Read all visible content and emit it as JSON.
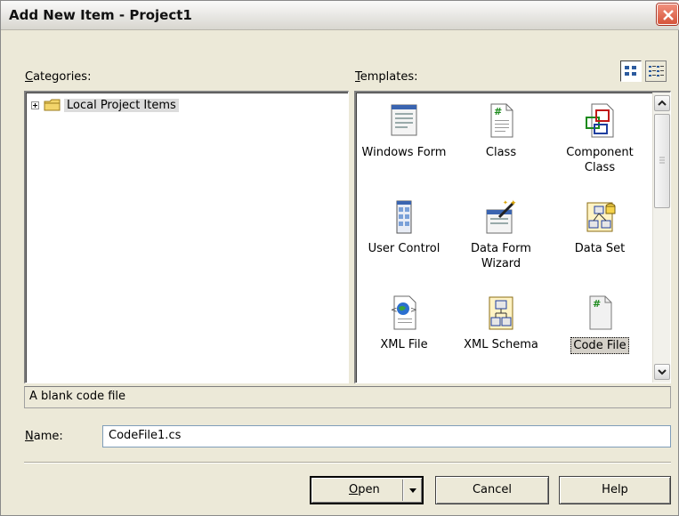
{
  "window": {
    "title": "Add New Item - Project1"
  },
  "categories": {
    "label_accel": "C",
    "label_rest": "ategories:",
    "tree": [
      {
        "label": "Local Project Items",
        "icon": "folder-icon",
        "expanded": false,
        "selected": true
      }
    ]
  },
  "templates": {
    "label_accel": "T",
    "label_rest": "emplates:",
    "view_large_icons": "large-icons-view-icon",
    "view_list": "list-view-icon",
    "items": [
      {
        "label": "Windows Form",
        "icon": "windows-form-icon"
      },
      {
        "label": "Class",
        "icon": "class-file-icon"
      },
      {
        "label": "Component Class",
        "icon": "component-class-icon"
      },
      {
        "label": "User Control",
        "icon": "user-control-icon"
      },
      {
        "label": "Data Form Wizard",
        "icon": "data-form-wizard-icon"
      },
      {
        "label": "Data Set",
        "icon": "data-set-icon"
      },
      {
        "label": "XML File",
        "icon": "xml-file-icon"
      },
      {
        "label": "XML Schema",
        "icon": "xml-schema-icon"
      },
      {
        "label": "Code File",
        "icon": "code-file-icon",
        "selected": true
      }
    ]
  },
  "description": "A blank code file",
  "name_field": {
    "label_accel": "N",
    "label_rest": "ame:",
    "value": "CodeFile1.cs"
  },
  "buttons": {
    "open_accel": "O",
    "open_rest": "pen",
    "cancel": "Cancel",
    "help": "Help"
  },
  "colors": {
    "dialog_bg": "#ece9d8",
    "close_button": "#d6543a",
    "selection": "#d4d0c8"
  }
}
